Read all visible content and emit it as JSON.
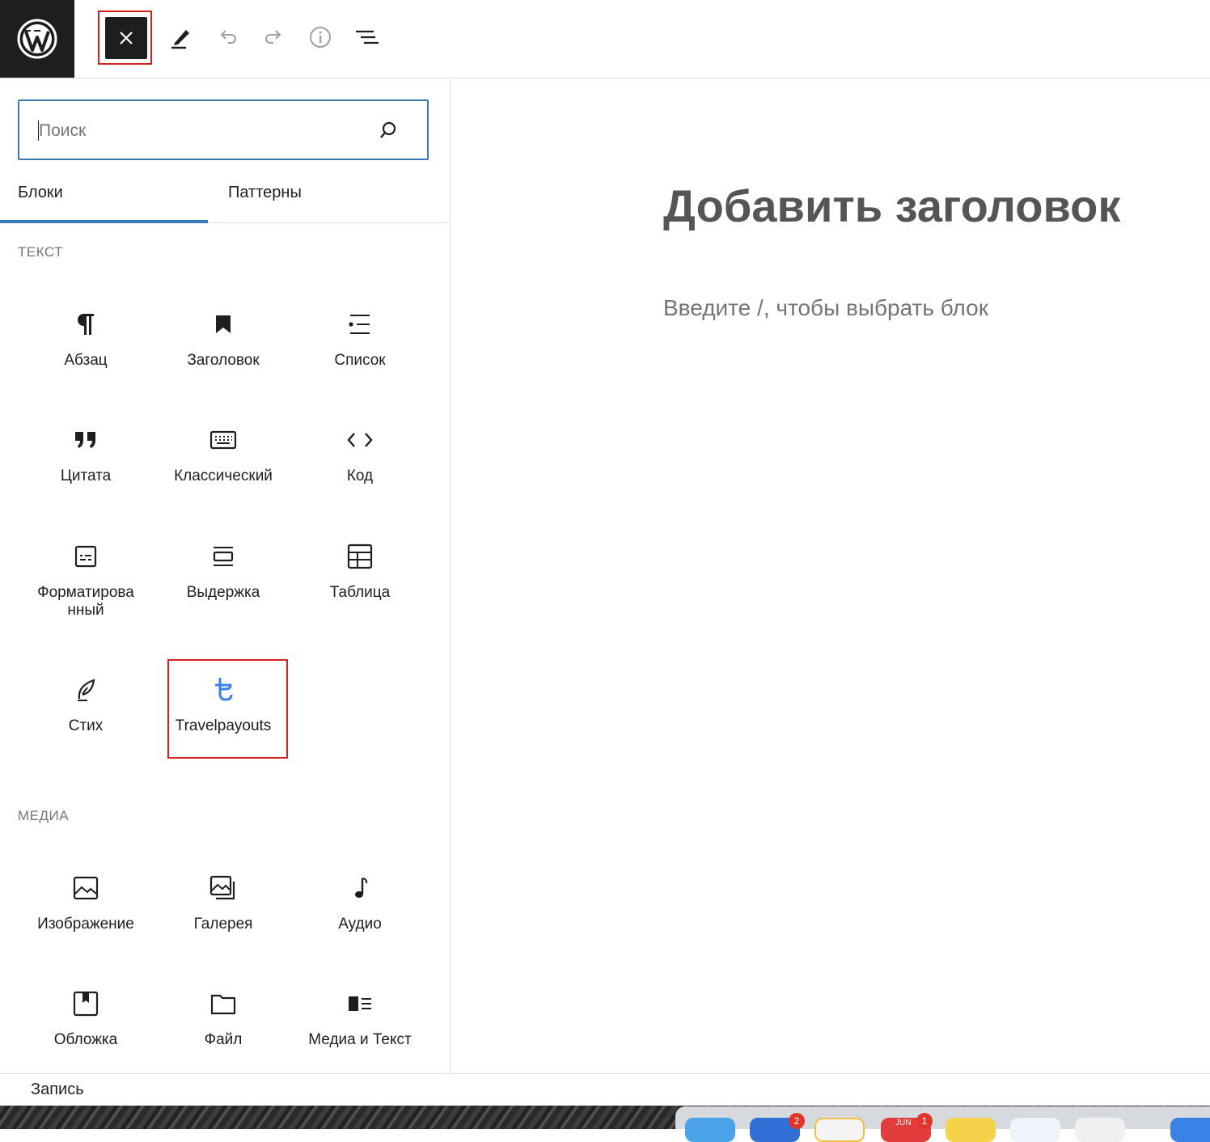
{
  "toolbar": {
    "logo_icon": "wordpress-logo",
    "close_icon": "close-icon",
    "tools": [
      "edit-pencil-icon",
      "undo-icon",
      "redo-icon",
      "info-icon",
      "list-view-icon"
    ]
  },
  "inserter": {
    "search": {
      "placeholder": "Поиск"
    },
    "tabs": {
      "blocks": "Блоки",
      "patterns": "Паттерны"
    },
    "categories": {
      "text": {
        "title": "ТЕКСТ",
        "blocks": {
          "paragraph": "Абзац",
          "heading": "Заголовок",
          "list": "Список",
          "quote": "Цитата",
          "classic": "Классический",
          "code": "Код",
          "preformatted": "Форматирова нный",
          "pullquote": "Выдержка",
          "table": "Таблица",
          "verse": "Стих",
          "travelpayouts": "Travelpayouts"
        }
      },
      "media": {
        "title": "МЕДИА",
        "blocks": {
          "image": "Изображение",
          "gallery": "Галерея",
          "audio": "Аудио",
          "cover": "Обложка",
          "file": "Файл",
          "media_text": "Медиа и Текст"
        }
      }
    }
  },
  "editor": {
    "title_placeholder": "Добавить заголовок",
    "block_hint": "Введите /, чтобы выбрать блок"
  },
  "footer": {
    "breadcrumb": "Запись"
  },
  "dock": {
    "badges": [
      "2",
      "1"
    ],
    "calendar_month": "JUN"
  },
  "colors": {
    "accent": "#3a7ab3",
    "highlight": "#d92020",
    "travelpayouts": "#3b82e6"
  }
}
